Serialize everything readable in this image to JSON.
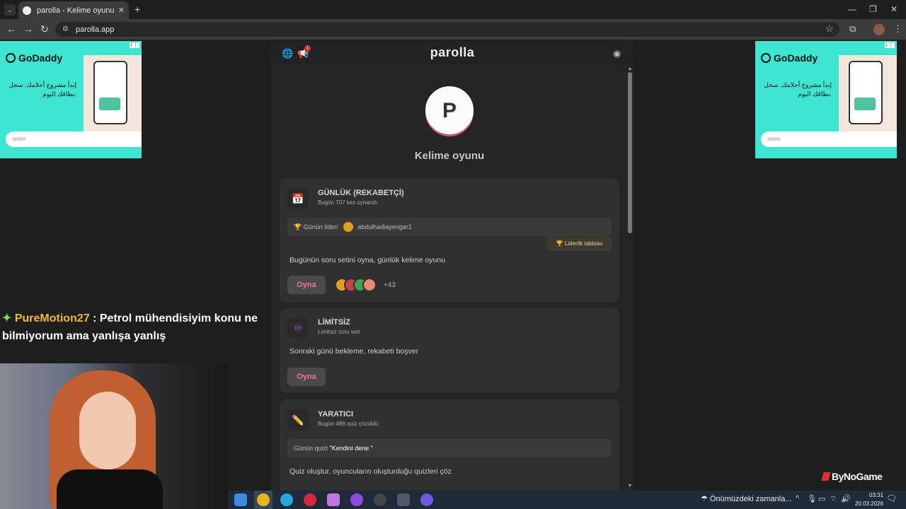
{
  "browser": {
    "tab_title": "parolla - Kelime oyunu. Günlük",
    "tab_close": "✕",
    "new_tab": "+",
    "url": "parolla.app",
    "nav": {
      "back": "←",
      "forward": "→",
      "reload": "↻"
    },
    "window": {
      "minimize": "—",
      "restore": "❐",
      "close": "✕"
    }
  },
  "ads": {
    "logo": "GoDaddy",
    "text": "إبدأ مشروع أحلامك. سجل نطاقك اليوم.",
    "www": "www."
  },
  "site": {
    "brand": "parolla",
    "notification_count": "1",
    "logo_letter": "P",
    "page_title": "Kelime oyunu",
    "cards": [
      {
        "icon": "📅",
        "title": "GÜNLÜK (REKABETÇİ)",
        "subtitle": "Bugün 707 kez oynandı",
        "leader_label": "Günün lideri",
        "leader_name": "abdulhadiayengar1",
        "leaderboard_button": "🏆 Liderlik tablosu",
        "description": "Bugünün soru setini oyna, günlük kelime oyunu",
        "play": "Oyna",
        "players_more": "+43"
      },
      {
        "icon": "♾",
        "title": "LİMİTSİZ",
        "subtitle": "Limitsiz soru seti",
        "description": "Sonraki günü bekleme, rekabeti boşver",
        "play": "Oyna"
      },
      {
        "icon": "✏️",
        "title": "YARATICI",
        "subtitle": "Bugün 488 quiz çözüldü",
        "quiz_label": "Günün quizi",
        "quiz_name": "\"Kendini dene \"",
        "description": "Quiz oluştur, oyuncuların oluşturduğu quizleri çöz"
      }
    ]
  },
  "stream": {
    "chat_user": "PureMotion27",
    "chat_text": " : Petrol mühendisiyim konu ne bilmiyorum ama yanlışa yanlış",
    "watermark": "ByNoGame"
  },
  "taskbar": {
    "weather_text": "Önümüzdeki zamanla...",
    "time": "03:31",
    "date": "20.03.2026"
  },
  "colors": {
    "accent_play": "#f07585",
    "ad_bg": "#3ee6d2",
    "badge": "#e0302f"
  }
}
